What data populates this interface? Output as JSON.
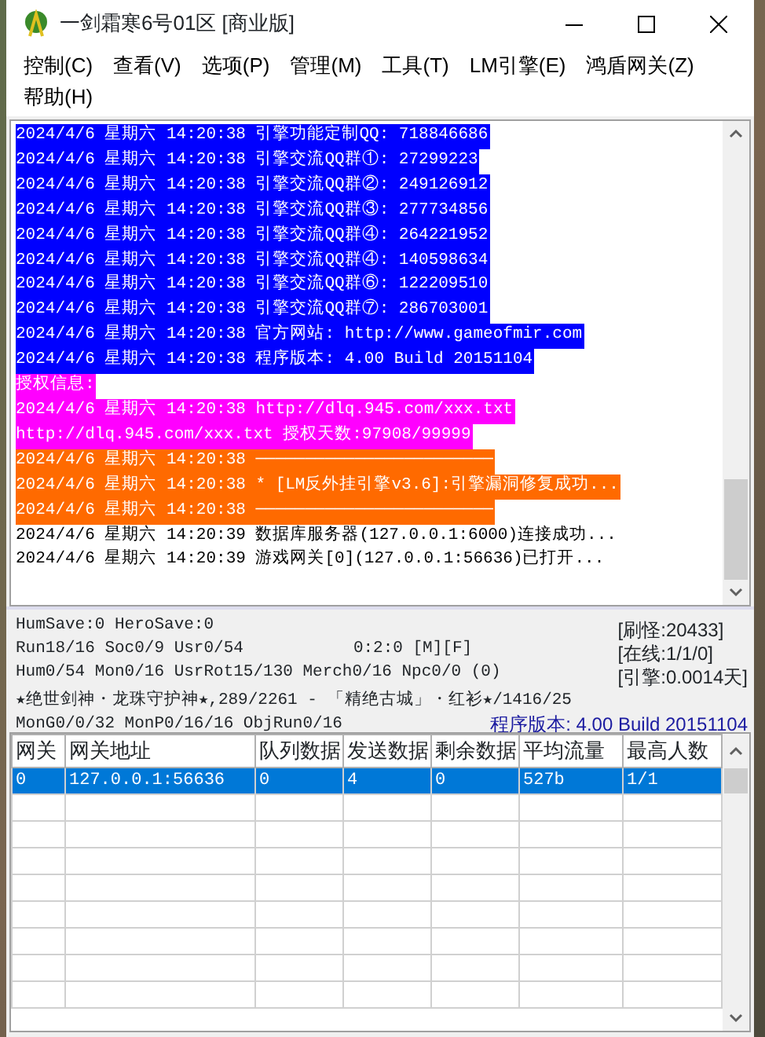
{
  "window": {
    "title": "一剑霜寒6号01区 [商业版]"
  },
  "menu": [
    {
      "label": "控制(C)"
    },
    {
      "label": "查看(V)"
    },
    {
      "label": "选项(P)"
    },
    {
      "label": "管理(M)"
    },
    {
      "label": "工具(T)"
    },
    {
      "label": "LM引擎(E)"
    },
    {
      "label": "鸿盾网关(Z)"
    },
    {
      "label": "帮助(H)"
    }
  ],
  "log": [
    {
      "text": "2024/4/6 星期六 14:20:38 引擎功能定制QQ: 718846686",
      "color": "#0000ff"
    },
    {
      "text": "2024/4/6 星期六 14:20:38 引擎交流QQ群①: 27299223",
      "color": "#0000ff"
    },
    {
      "text": "2024/4/6 星期六 14:20:38 引擎交流QQ群②: 249126912",
      "color": "#0000ff"
    },
    {
      "text": "2024/4/6 星期六 14:20:38 引擎交流QQ群③: 277734856",
      "color": "#0000ff"
    },
    {
      "text": "2024/4/6 星期六 14:20:38 引擎交流QQ群④: 264221952",
      "color": "#0000ff"
    },
    {
      "text": "2024/4/6 星期六 14:20:38 引擎交流QQ群④: 140598634",
      "color": "#0000ff"
    },
    {
      "text": "2024/4/6 星期六 14:20:38 引擎交流QQ群⑥: 122209510",
      "color": "#0000ff"
    },
    {
      "text": "2024/4/6 星期六 14:20:38 引擎交流QQ群⑦: 286703001",
      "color": "#0000ff"
    },
    {
      "text": "2024/4/6 星期六 14:20:38 官方网站: http://www.gameofmir.com",
      "color": "#0000ff"
    },
    {
      "text": "2024/4/6 星期六 14:20:38 程序版本: 4.00 Build 20151104",
      "color": "#0000ff"
    },
    {
      "text": "授权信息:",
      "color": "#ff00ff"
    },
    {
      "text": "2024/4/6 星期六 14:20:38 http://dlq.945.com/xxx.txt",
      "color": "#ff00ff"
    },
    {
      "text": "http://dlq.945.com/xxx.txt 授权天数:97908/99999",
      "color": "#ff00ff"
    },
    {
      "text": "2024/4/6 星期六 14:20:38 ────────────────────────",
      "color": "#ff6a00"
    },
    {
      "text": "2024/4/6 星期六 14:20:38 * [LM反外挂引擎v3.6]:引擎漏洞修复成功...",
      "color": "#ff6a00"
    },
    {
      "text": "2024/4/6 星期六 14:20:38 ────────────────────────",
      "color": "#ff6a00"
    },
    {
      "text": "2024/4/6 星期六 14:20:39 数据库服务器(127.0.0.1:6000)连接成功..."
    },
    {
      "text": "2024/4/6 星期六 14:20:39 游戏网关[0](127.0.0.1:56636)已打开..."
    }
  ],
  "status": {
    "lines": [
      "HumSave:0 HeroSave:0",
      "Run18/16 Soc0/9 Usr0/54",
      "Hum0/54 Mon0/16 UsrRot15/130 Merch0/16 Npc0/0 (0)",
      "★绝世剑神・龙珠守护神★,289/2261 - 「精绝古城」・红衫★/1416/25",
      "MonG0/0/32 MonP0/16/16 ObjRun0/16"
    ],
    "timer": "0:2:0 [M][F]",
    "counters": [
      "[刷怪:20433]",
      "[在线:1/1/0]",
      "[引擎:0.0014天]"
    ],
    "version": "程序版本: 4.00 Build 20151104"
  },
  "gateway_table": {
    "columns": [
      "网关",
      "网关地址",
      "队列数据",
      "发送数据",
      "剩余数据",
      "平均流量",
      "最高人数"
    ],
    "rows": [
      {
        "cells": [
          "0",
          "127.0.0.1:56636",
          "0",
          "4",
          "0",
          "527b",
          "1/1"
        ],
        "selected": true
      }
    ]
  }
}
